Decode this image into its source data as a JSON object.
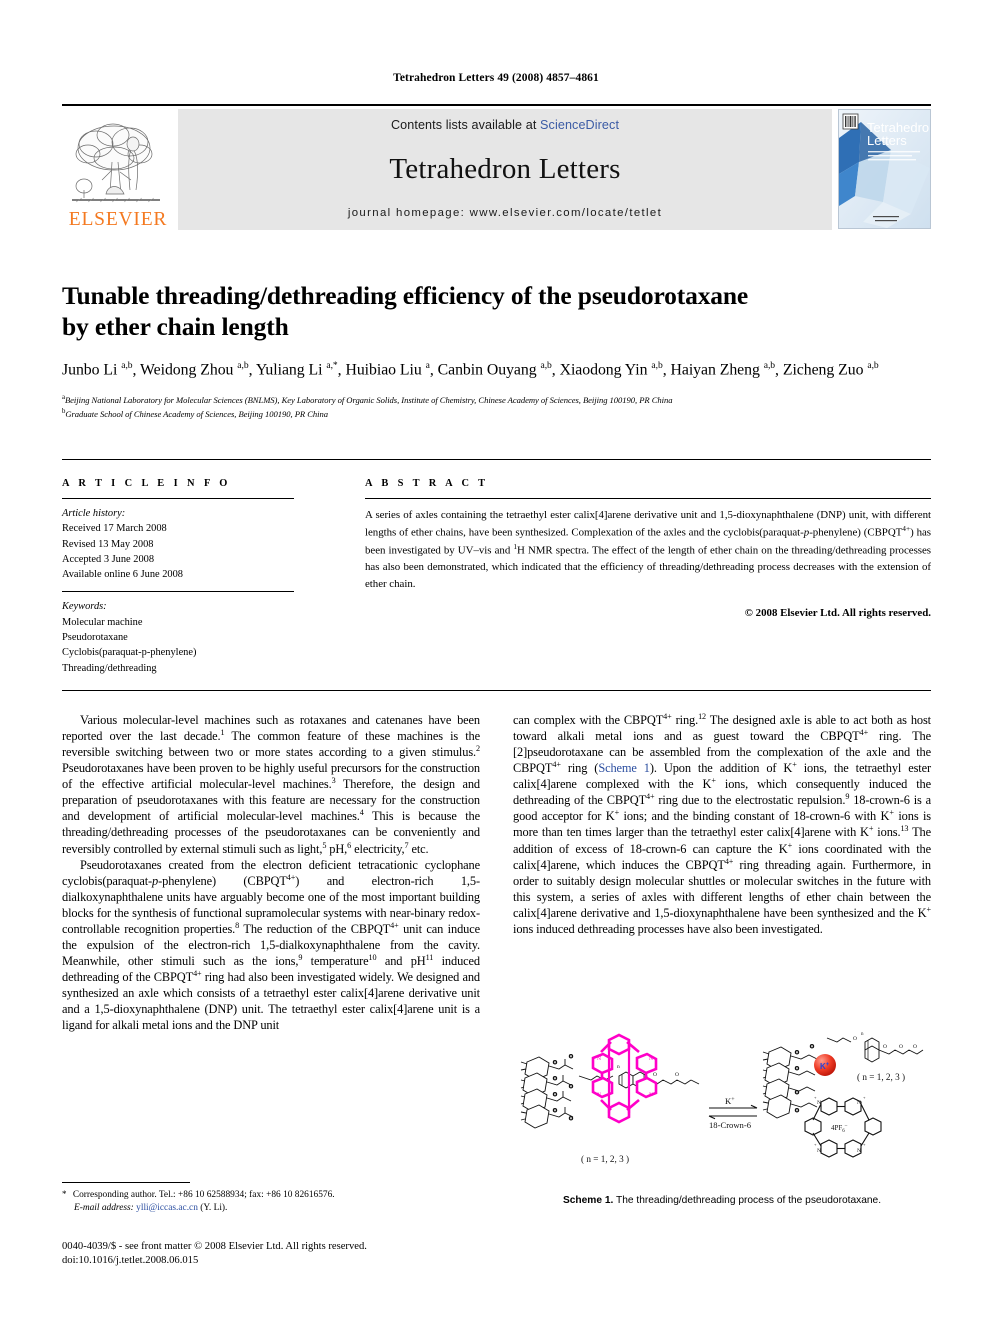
{
  "running_head": "Tetrahedron Letters 49 (2008) 4857–4861",
  "masthead": {
    "contents_prefix": "Contents lists available at ",
    "sciencedirect": "ScienceDirect",
    "journal_title": "Tetrahedron Letters",
    "homepage": "journal homepage: www.elsevier.com/locate/tetlet",
    "publisher": "ELSEVIER",
    "cover_title_line1": "Tetrahedron",
    "cover_title_line2": "Letters",
    "link_color": "#3b5ba5",
    "brand_color": "#F47920"
  },
  "article": {
    "title_line1": "Tunable threading/dethreading efficiency of the pseudorotaxane",
    "title_line2": "by ether chain length",
    "authors_html": "Junbo Li <sup>a,b</sup>, Weidong Zhou <sup>a,b</sup>, Yuliang Li <sup>a,</sup><sup>*</sup>, Huibiao Liu <sup>a</sup>, Canbin Ouyang <sup>a,b</sup>, Xiaodong Yin <sup>a,b</sup>, Haiyan Zheng <sup>a,b</sup>, Zicheng Zuo <sup>a,b</sup>",
    "affiliation_a": "Beijing National Laboratory for Molecular Sciences (BNLMS), Key Laboratory of Organic Solids, Institute of Chemistry, Chinese Academy of Sciences, Beijing 100190, PR China",
    "affiliation_b": "Graduate School of Chinese Academy of Sciences, Beijing 100190, PR China"
  },
  "info": {
    "heading": "A R T I C L E     I N F O",
    "history_label": "Article history:",
    "history": [
      "Received 17 March 2008",
      "Revised 13 May 2008",
      "Accepted 3 June 2008",
      "Available online 6 June 2008"
    ],
    "keywords_label": "Keywords:",
    "keywords": [
      "Molecular machine",
      "Pseudorotaxane",
      "Cyclobis(paraquat-p-phenylene)",
      "Threading/dethreading"
    ]
  },
  "abstract": {
    "heading": "A B S T R A C T",
    "body_html": "A series of axles containing the tetraethyl ester calix[4]arene derivative unit and 1,5-dioxynaphthalene (DNP) unit, with different lengths of ether chains, have been synthesized. Complexation of the axles and the cyclobis(paraquat-<i>p</i>-phenylene) (CBPQT<sup>4+</sup>) has been investigated by UV–vis and <sup>1</sup>H NMR spectra. The effect of the length of ether chain on the threading/dethreading processes has also been demonstrated, which indicated that the efficiency of threading/dethreading process decreases with the extension of ether chain.",
    "copyright": "© 2008 Elsevier Ltd. All rights reserved."
  },
  "body": {
    "left_paragraphs_html": [
      "Various molecular-level machines such as rotaxanes and catenanes have been reported over the last decade.<sup>1</sup> The common feature of these machines is the reversible switching between two or more states according to a given stimulus.<sup>2</sup> Pseudorotaxanes have been proven to be highly useful precursors for the construction of the effective artificial molecular-level machines.<sup>3</sup> Therefore, the design and preparation of pseudorotaxanes with this feature are necessary for the construction and development of artificial molecular-level machines.<sup>4</sup> This is because the threading/dethreading processes of the pseudorotaxanes can be conveniently and reversibly controlled by external stimuli such as light,<sup>5</sup> pH,<sup>6</sup> electricity,<sup>7</sup> etc.",
      "Pseudorotaxanes created from the electron deficient tetracationic cyclophane cyclobis(paraquat-<i>p</i>-phenylene) (CBPQT<sup>4+</sup>) and electron-rich 1,5-dialkoxynaphthalene units have arguably become one of the most important building blocks for the synthesis of functional supramolecular systems with near-binary redox-controllable recognition properties.<sup>8</sup> The reduction of the CBPQT<sup>4+</sup> unit can induce the expulsion of the electron-rich 1,5-dialkoxynaphthalene from the cavity. Meanwhile, other stimuli such as the ions,<sup>9</sup> temperature<sup>10</sup> and pH<sup>11</sup> induced dethreading of the CBPQT<sup>4+</sup> ring had also been investigated widely. We designed and synthesized an axle which consists of a tetraethyl ester calix[4]arene derivative unit and a 1,5-dioxynaphthalene (DNP) unit. The tetraethyl ester calix[4]arene unit is a ligand for alkali metal ions and the DNP unit"
    ],
    "right_paragraphs_html": [
      "can complex with the CBPQT<sup>4+</sup> ring.<sup>12</sup> The designed axle is able to act both as host toward alkali metal ions and as guest toward the CBPQT<sup>4+</sup> ring. The [2]pseudorotaxane can be assembled from the complexation of the axle and the CBPQT<sup>4+</sup> ring (<span class=\"link\">Scheme 1</span>). Upon the addition of K<sup>+</sup> ions, the tetraethyl ester calix[4]arene complexed with the K<sup>+</sup> ions, which consequently induced the dethreading of the CBPQT<sup>4+</sup> ring due to the electrostatic repulsion.<sup>9</sup> 18-crown-6 is a good acceptor for K<sup>+</sup> ions; and the binding constant of 18-crown-6 with K<sup>+</sup> ions is more than ten times larger than the tetraethyl ester calix[4]arene with K<sup>+</sup> ions.<sup>13</sup> The addition of excess of 18-crown-6 can capture the K<sup>+</sup> ions coordinated with the calix[4]arene, which induces the CBPQT<sup>4+</sup> ring threading again. Furthermore, in order to suitably design molecular shuttles or molecular switches in the future with this system, a series of axles with different lengths of ether chain between the calix[4]arene derivative and 1,5-dioxynaphthalene have been synthesized and the K<sup>+</sup> ions induced dethreading processes have also been investigated."
    ]
  },
  "scheme": {
    "caption_bold": "Scheme 1.",
    "caption_text": " The threading/dethreading process of the pseudorotaxane.",
    "label_left_n": "( n = 1, 2, 3 )",
    "label_right_n": "( n = 1, 2, 3 )",
    "arrow_top_label": "K",
    "arrow_top_sup": "+",
    "arrow_bottom_label": "18-Crown-6",
    "ion_label": "K",
    "ion_sup": "+",
    "counterion_label": "4PF",
    "counterion_sub": "6",
    "counterion_sup": "–",
    "ring_color": "#ff00c8",
    "ion_color": "#ee2222"
  },
  "footnote": {
    "corresponding_html": "<span class=\"star\">*</span> Corresponding author. Tel.: +86 10 62588934; fax: +86 10 82616576.",
    "email_label": "E-mail address:",
    "email": "ylli@iccas.ac.cn",
    "email_owner": "(Y. Li)."
  },
  "frontmatter": {
    "line1": "0040-4039/$ - see front matter © 2008 Elsevier Ltd. All rights reserved.",
    "line2": "doi:10.1016/j.tetlet.2008.06.015"
  }
}
